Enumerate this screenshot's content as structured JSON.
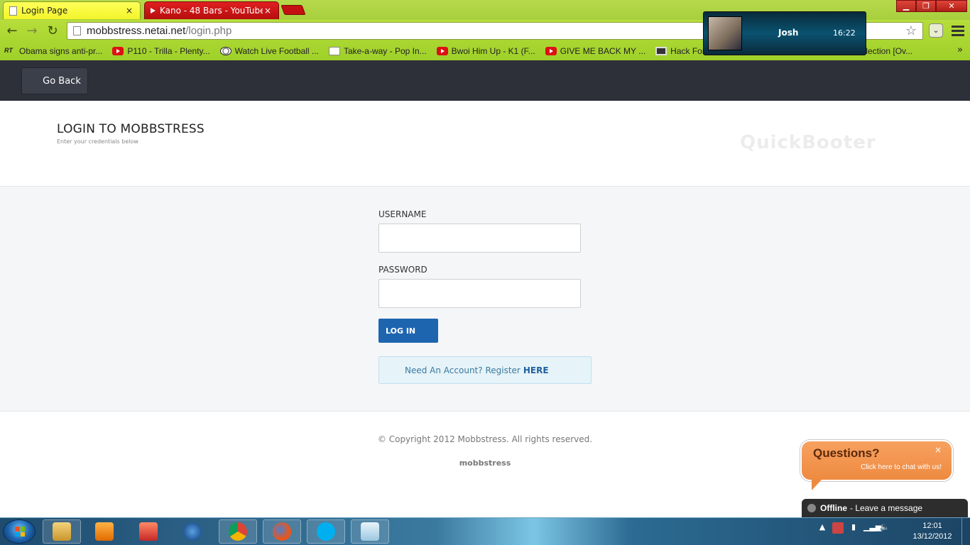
{
  "browser": {
    "tabs": [
      {
        "label": "Login Page",
        "close": "×"
      },
      {
        "label": "Kano - 48 Bars - YouTube",
        "close": "×"
      }
    ],
    "url_host": "mobbstress.netai.net",
    "url_path": "/login.php",
    "bookmarks": [
      {
        "label": "Obama signs anti-pr...",
        "icon": "rt-icon",
        "icon_text": "RT"
      },
      {
        "label": "P110 - Trilla - Plenty...",
        "icon": "youtube-icon"
      },
      {
        "label": "Watch Live Football ...",
        "icon": "football-icon"
      },
      {
        "label": "Take-a-way - Pop In...",
        "icon": "page-icon"
      },
      {
        "label": "Bwoi Him Up - K1 (F...",
        "icon": "youtube-icon"
      },
      {
        "label": "GIVE ME BACK MY ...",
        "icon": "youtube-icon"
      },
      {
        "label": "Hack Forum",
        "icon": "laptop-icon"
      },
      {
        "label": "ollection [Ov...",
        "icon": "none"
      }
    ],
    "bookmarks_more": "»"
  },
  "call_popup": {
    "name": "Josh",
    "time": "16:22"
  },
  "page": {
    "go_back": "Go Back",
    "title": "LOGIN TO MOBBSTRESS",
    "subtitle": "Enter your credentials below",
    "brand": "QuickBooter",
    "username_label": "USERNAME",
    "username_value": "",
    "password_label": "PASSWORD",
    "password_value": "",
    "login_button": "LOG IN",
    "register_text": "Need An Account? Register",
    "register_link": "HERE",
    "copyright": "© Copyright 2012 Mobbstress. All rights reserved.",
    "footer_brand": "mobbstress"
  },
  "chat": {
    "title": "Questions?",
    "subtitle": "Click here to chat with us!",
    "close": "×",
    "status": "Offline",
    "status_text": "- Leave a message"
  },
  "taskbar": {
    "time": "12:01",
    "date": "13/12/2012"
  },
  "colors": {
    "topbar": "#2d3039",
    "login_button": "#1e65b0",
    "register_box": "#e6f3f8",
    "chat_bubble": "#ee8a40"
  }
}
